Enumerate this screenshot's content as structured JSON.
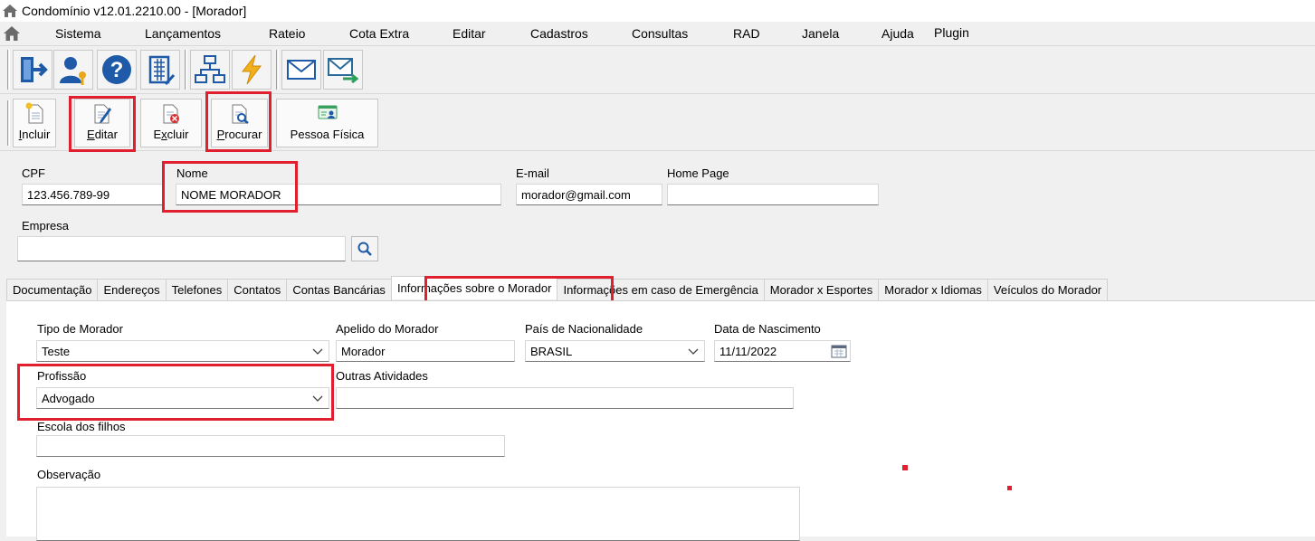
{
  "window": {
    "title": "Condomínio v12.01.2210.00 - [Morador]"
  },
  "menu": [
    "Sistema",
    "Lançamentos",
    "Rateio",
    "Cota Extra",
    "Editar",
    "Cadastros",
    "Consultas",
    "RAD",
    "Janela",
    "Ajuda",
    "Plugin"
  ],
  "toolbar1": {
    "icons": [
      "exit-icon",
      "user-key-icon",
      "help-icon",
      "building-icon",
      "network-icon",
      "lightning-icon",
      "mail-icon",
      "mail-send-icon"
    ]
  },
  "actions": {
    "incluir_pre": "",
    "incluir_ul": "I",
    "incluir_post": "ncluir",
    "editar_pre": "",
    "editar_ul": "E",
    "editar_post": "ditar",
    "excluir_pre": "E",
    "excluir_ul": "x",
    "excluir_post": "cluir",
    "procurar_pre": "",
    "procurar_ul": "P",
    "procurar_post": "rocurar",
    "pessoa": "Pessoa Física"
  },
  "form": {
    "cpf_label": "CPF",
    "cpf_value": "123.456.789-99",
    "nome_label": "Nome",
    "nome_value": "NOME MORADOR",
    "email_label": "E-mail",
    "email_value": "morador@gmail.com",
    "homepage_label": "Home Page",
    "homepage_value": "",
    "empresa_label": "Empresa",
    "empresa_value": ""
  },
  "tabs": [
    "Documentação",
    "Endereços",
    "Telefones",
    "Contatos",
    "Contas Bancárias",
    "Informações sobre o Morador",
    "Informações em caso de Emergência",
    "Morador x Esportes",
    "Morador x Idiomas",
    "Veículos do Morador"
  ],
  "active_tab": "Informações sobre o Morador",
  "panel": {
    "tipo_label": "Tipo de Morador",
    "tipo_value": "Teste",
    "apelido_label": "Apelido do  Morador",
    "apelido_value": "Morador",
    "pais_label": "País de Nacionalidade",
    "pais_value": "BRASIL",
    "nasc_label": "Data de Nascimento",
    "nasc_value": "11/11/2022",
    "profissao_label": "Profissão",
    "profissao_value": "Advogado",
    "outras_label": "Outras Atividades",
    "outras_value": "",
    "escola_label": "Escola dos filhos",
    "escola_value": "",
    "obs_label": "Observação",
    "obs_value": ""
  },
  "colors": {
    "highlight": "#e0202e",
    "window_bg": "#f0f0f0"
  }
}
